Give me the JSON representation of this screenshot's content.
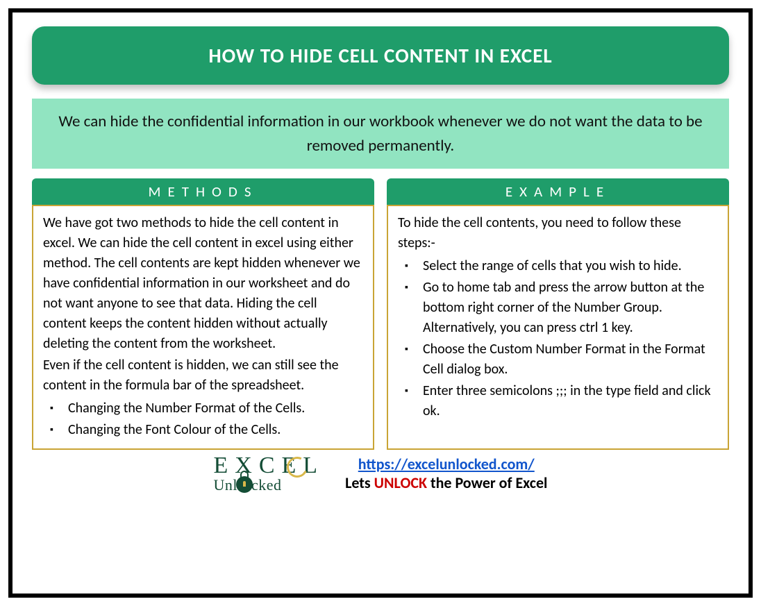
{
  "title": "HOW TO HIDE CELL CONTENT IN EXCEL",
  "intro": "We can hide the confidential information in our workbook whenever we do not want the data to be removed permanently.",
  "methods": {
    "header": "METHODS",
    "para1": "We have got two methods to hide the cell content in excel. We can hide the cell content in excel using either method. The cell contents are kept hidden whenever we have confidential information in our worksheet and do not want anyone to see that data. Hiding the cell content keeps the content hidden without actually deleting the content from the worksheet.",
    "para2": "Even if the cell content is hidden, we can still see the content in the formula bar of the spreadsheet.",
    "bullets": [
      "Changing the Number Format of the Cells.",
      "Changing the Font Colour of the Cells."
    ]
  },
  "example": {
    "header": "EXAMPLE",
    "para1": "To hide the cell contents, you need to follow these steps:-",
    "bullets": [
      "Select the range of cells that you wish to hide.",
      "Go to home tab and press the arrow button at the bottom right corner of the Number Group. Alternatively, you can press ctrl 1 key.",
      "Choose the Custom Number Format in the Format Cell dialog box.",
      "Enter three semicolons ;;; in the type field and click ok."
    ]
  },
  "footer": {
    "logo_top": "EXCEL",
    "logo_bottom_pre": "Unl",
    "logo_bottom_post": "cked",
    "url": "https://excelunlocked.com/",
    "tagline_pre": "Lets ",
    "tagline_unlock": "UNLOCK",
    "tagline_post": " the Power of Excel"
  }
}
